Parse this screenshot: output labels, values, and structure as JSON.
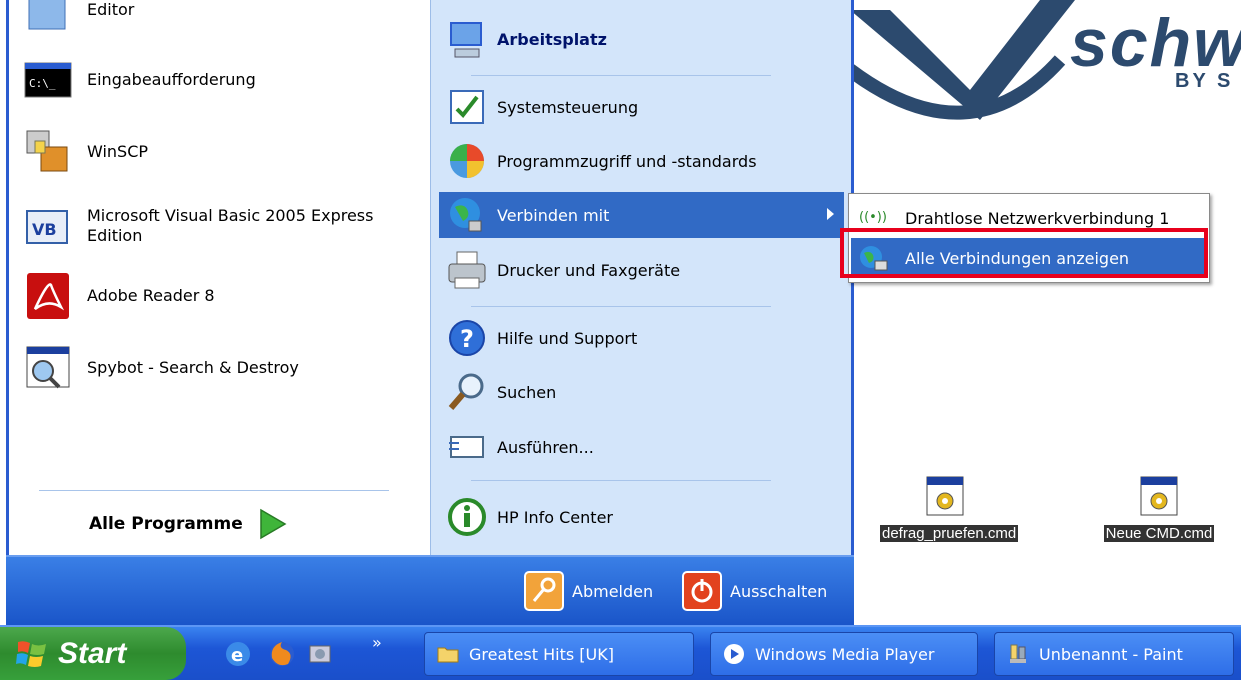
{
  "start_menu": {
    "left_items": [
      {
        "label": "Editor",
        "icon": "notepad-icon"
      },
      {
        "label": "Eingabeaufforderung",
        "icon": "command-prompt-icon"
      },
      {
        "label": "WinSCP",
        "icon": "winscp-icon"
      },
      {
        "label": "Microsoft Visual Basic 2005 Express Edition",
        "icon": "visual-basic-icon"
      },
      {
        "label": "Adobe Reader 8",
        "icon": "adobe-reader-icon"
      },
      {
        "label": "Spybot - Search & Destroy",
        "icon": "spybot-icon"
      }
    ],
    "all_programs_label": "Alle Programme",
    "right_items": [
      {
        "label": "Arbeitsplatz",
        "icon": "my-computer-icon"
      },
      {
        "label": "Systemsteuerung",
        "icon": "control-panel-icon"
      },
      {
        "label": "Programmzugriff und -standards",
        "icon": "program-access-icon"
      },
      {
        "label": "Verbinden mit",
        "icon": "connect-to-icon"
      },
      {
        "label": "Drucker und Faxgeräte",
        "icon": "printer-icon"
      },
      {
        "label": "Hilfe und Support",
        "icon": "help-icon"
      },
      {
        "label": "Suchen",
        "icon": "search-icon"
      },
      {
        "label": "Ausführen...",
        "icon": "run-icon"
      },
      {
        "label": "HP Info Center",
        "icon": "hp-info-icon"
      }
    ],
    "logoff_label": "Abmelden",
    "shutdown_label": "Ausschalten"
  },
  "submenu": {
    "items": [
      {
        "label": "Drahtlose Netzwerkverbindung 1",
        "icon": "wireless-icon"
      },
      {
        "label": "Alle Verbindungen anzeigen",
        "icon": "network-connections-icon",
        "selected": true
      }
    ]
  },
  "desktop": {
    "logo_text": "schw",
    "logo_subtext": "BY S",
    "icons": [
      {
        "label": "defrag_pruefen.cmd",
        "icon": "cmd-file-icon"
      },
      {
        "label": "Neue CMD.cmd",
        "icon": "cmd-file-icon"
      }
    ]
  },
  "taskbar": {
    "start_label": "Start",
    "quick_launch": [
      "ie-icon",
      "firefox-icon",
      "media-icon"
    ],
    "quick_launch_more": "»",
    "buttons": [
      {
        "label": "Greatest Hits [UK]",
        "icon": "folder-icon"
      },
      {
        "label": "Windows Media Player",
        "icon": "media-player-icon"
      },
      {
        "label": "Unbenannt - Paint",
        "icon": "paint-icon"
      }
    ]
  },
  "colors": {
    "highlight_box": "#e8001c",
    "selection": "#316ac5",
    "menu_blue": "#2a5cd0",
    "taskbar_blue": "#1d56d6",
    "start_green": "#2e8b2e"
  }
}
